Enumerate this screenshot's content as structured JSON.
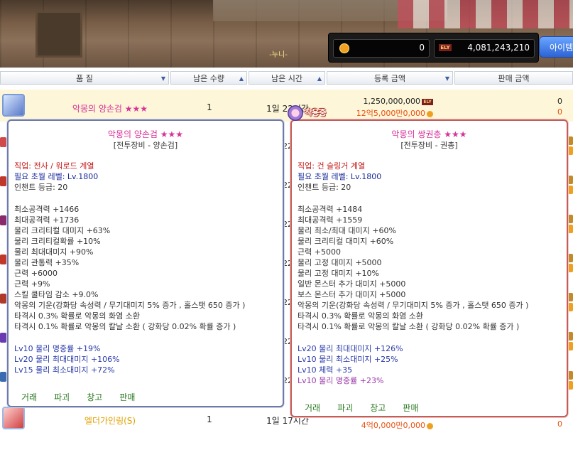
{
  "header": {
    "deco_text": "-누니-",
    "currency": {
      "coin_value": "0",
      "ely_label": "ELY",
      "ely_value": "4,081,243,210"
    },
    "item_button_label": "아이템"
  },
  "columns": {
    "quality": "품 질",
    "remaining_qty": "남은 수량",
    "remaining_time": "남은 시간",
    "register_price": "등록 금액",
    "sell_price": "판매 금액"
  },
  "rows": [
    {
      "name": "악몽의 양손검 ★★★",
      "qty": "1",
      "time": "1일 22시간",
      "price": "1,250,000,000",
      "price_alt": "12억5,000만0,000",
      "sell": "0",
      "sell_alt": "0"
    },
    {
      "name": "엘더가인링(S)",
      "qty": "1",
      "time": "1일 17시간",
      "price_alt": "4억0,000만0,000",
      "sell": "0",
      "sell_alt": "0"
    }
  ],
  "partial_row_times": [
    "22",
    "22",
    "22",
    "22",
    "22",
    "22",
    "22",
    "17"
  ],
  "inuse_label": "착용중",
  "tooltip_left": {
    "title": "악몽의 양손검 ★★★",
    "subtitle": "[전투장비 - 양손검]",
    "job": "직업: 전사 / 워로드 계열",
    "req_level": "필요 초월 레벨: Lv.1800",
    "enchant": "인챈트 등급: 20",
    "stats": [
      "최소공격력 +1466",
      "최대공격력 +1736",
      "물리 크리티컬 대미지 +63%",
      "물리 크리티컬확률 +10%",
      "물리 최대대미지 +90%",
      "물리 관통력 +35%",
      "근력 +6000",
      "근력 +9%",
      "스킬 쿨타임 감소 +9.0%"
    ],
    "effects": [
      "악몽의 기운(강화당 속성력 / 무기대미지 5% 증가 , 홀스탯 650 증가 )",
      "타격시 0.3% 확률로 악몽의 화염 소환",
      "타격시 0.1% 확률로 악몽의 칼날 소환 ( 강화당 0.02% 확률 증가 )"
    ],
    "potentials": [
      "Lv10 물리 명중률 +19%",
      "Lv20 물리 최대대미지 +106%",
      "Lv15 물리 최소대미지 +72%"
    ],
    "actions": [
      "거래",
      "파괴",
      "창고",
      "판매"
    ]
  },
  "tooltip_right": {
    "title": "악몽의 쌍권총 ★★★",
    "subtitle": "[전투장비 - 권총]",
    "job": "직업: 건 슬링거 계열",
    "req_level": "필요 초월 레벨: Lv.1800",
    "enchant": "인챈트 등급: 20",
    "stats": [
      "최소공격력 +1484",
      "최대공격력 +1559",
      "물리 최소/최대 대미지 +60%",
      "물리 크리티컬 대미지 +60%",
      "근력 +5000",
      "물리 고정 대미지 +5000",
      "물리 고정 대미지 +10%",
      "일반 몬스터 추가 대미지 +5000",
      "보스 몬스터 추가 대미지 +5000"
    ],
    "effects": [
      "악몽의 기운(강화당 속성력 / 무기대미지 5% 증가 , 홀스탯 650 증가 )",
      "타격시 0.3% 확률로 악몽의 화염 소환",
      "타격시 0.1% 확률로 악몽의 칼날 소환 ( 강화당 0.02% 확률 증가 )"
    ],
    "potentials": [
      "Lv20 물리 최대대미지 +126%",
      "Lv10 물리 최소대미지 +25%",
      "Lv10 체력 +35",
      "Lv10 물리 명중률 +23%"
    ],
    "actions": [
      "거래",
      "파괴",
      "창고",
      "판매"
    ]
  },
  "colors": {
    "title_pink": "#d6339a",
    "job_red": "#c41a1a",
    "req_blue": "#1a2a9a",
    "potential_blue": "#2a3aa8",
    "potential_purple": "#9a3aa8",
    "action_green": "#2a7a20",
    "price_orange": "#e85010"
  }
}
